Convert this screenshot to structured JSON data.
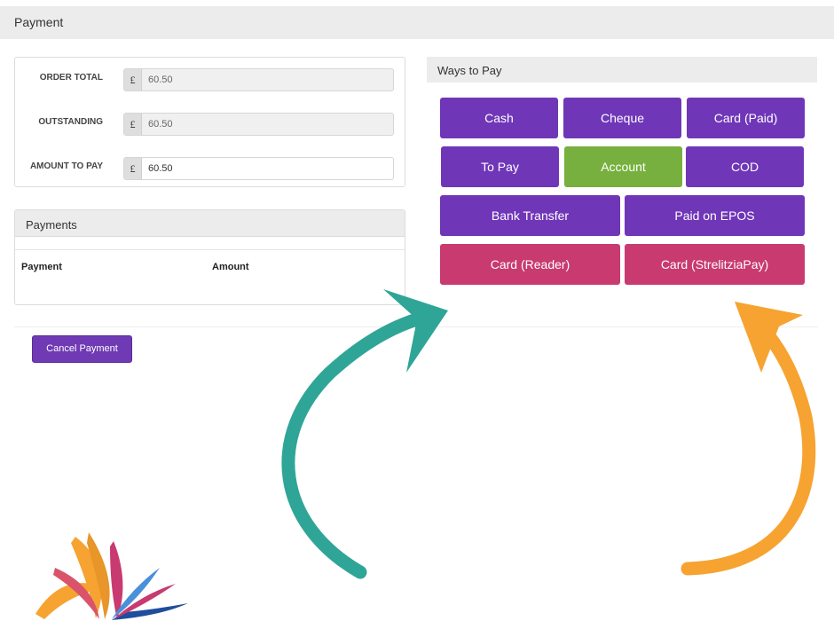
{
  "header": {
    "title": "Payment"
  },
  "summary": {
    "order_total": {
      "label": "ORDER TOTAL",
      "currency": "£",
      "value": "60.50"
    },
    "outstanding": {
      "label": "OUTSTANDING",
      "currency": "£",
      "value": "60.50"
    },
    "amount_to_pay": {
      "label": "AMOUNT TO PAY",
      "currency": "£",
      "value": "60.50"
    }
  },
  "payments": {
    "title": "Payments",
    "columns": [
      "Payment",
      "Amount"
    ]
  },
  "actions": {
    "cancel_label": "Cancel Payment"
  },
  "ways_to_pay": {
    "title": "Ways to Pay",
    "buttons": [
      {
        "label": "Cash",
        "style": "purple"
      },
      {
        "label": "Cheque",
        "style": "purple"
      },
      {
        "label": "Card (Paid)",
        "style": "purple"
      },
      {
        "label": "To Pay",
        "style": "purple"
      },
      {
        "label": "Account",
        "style": "green"
      },
      {
        "label": "COD",
        "style": "purple"
      },
      {
        "label": "Bank Transfer",
        "style": "purple"
      },
      {
        "label": "Paid on EPOS",
        "style": "purple"
      },
      {
        "label": "Card (Reader)",
        "style": "pink"
      },
      {
        "label": "Card (StrelitziaPay)",
        "style": "pink"
      }
    ]
  },
  "colors": {
    "primary_purple": "#7036b8",
    "account_green": "#77b03e",
    "card_pink": "#c83a70",
    "arrow_teal": "#2fa597",
    "arrow_orange": "#f6a331"
  },
  "decorations": {
    "arrows": [
      "teal-curved-arrow",
      "orange-curved-arrow"
    ],
    "logo": "strelitzia-flower-logo"
  }
}
